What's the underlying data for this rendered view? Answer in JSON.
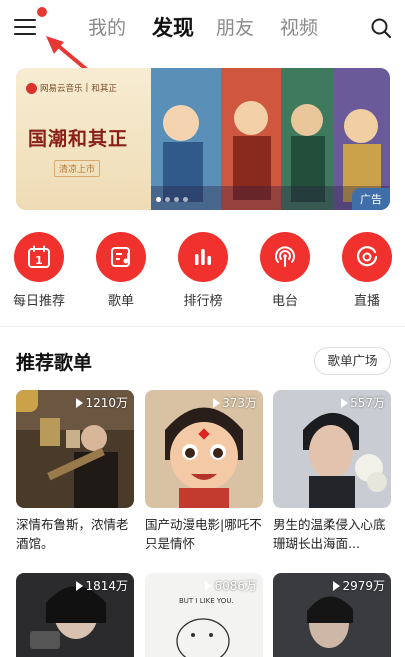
{
  "header": {
    "tabs": [
      {
        "label": "我的",
        "active": false
      },
      {
        "label": "发现",
        "active": true
      },
      {
        "label": "朋友",
        "active": false
      },
      {
        "label": "视频",
        "active": false
      }
    ]
  },
  "banner": {
    "brand": "网易云音乐",
    "brand_partner": "和其正",
    "title": "国潮和其正",
    "subtitle": "清凉上市",
    "badge": "广告"
  },
  "shortcuts": [
    {
      "label": "每日推荐",
      "icon": "calendar-icon",
      "day": "1"
    },
    {
      "label": "歌单",
      "icon": "playlist-icon"
    },
    {
      "label": "排行榜",
      "icon": "chart-bars-icon"
    },
    {
      "label": "电台",
      "icon": "radio-icon"
    },
    {
      "label": "直播",
      "icon": "live-icon"
    }
  ],
  "section": {
    "title": "推荐歌单",
    "more": "歌单广场"
  },
  "playlists": [
    {
      "count": "1210万",
      "title": "深情布鲁斯，浓情老酒馆。"
    },
    {
      "count": "373万",
      "title": "国产动漫电影|哪吒不只是情怀"
    },
    {
      "count": "557万",
      "title": "男生的温柔侵入心底 珊瑚长出海面..."
    },
    {
      "count": "1814万",
      "title": ""
    },
    {
      "count": "6086万",
      "title": ""
    },
    {
      "count": "2979万",
      "title": ""
    }
  ],
  "colors": {
    "accent": "#f0312d",
    "ad_badge": "#3f6ea8"
  }
}
